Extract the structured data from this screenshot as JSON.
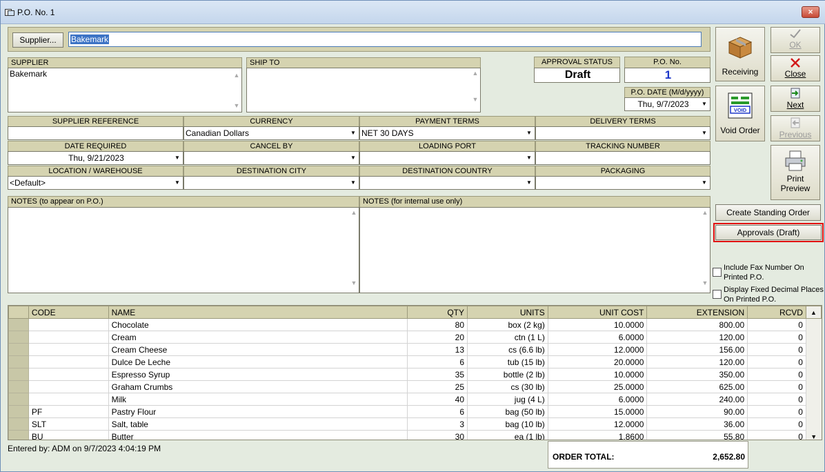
{
  "window": {
    "title": "P.O. No. 1",
    "close_label": "×"
  },
  "supplier_bar": {
    "button_label": "Supplier...",
    "value": "Bakemark"
  },
  "supplier_box": {
    "label": "SUPPLIER",
    "value": "Bakemark"
  },
  "ship_to": {
    "label": "SHIP TO",
    "value": ""
  },
  "approval_status": {
    "label": "APPROVAL STATUS",
    "value": "Draft"
  },
  "po_no": {
    "label": "P.O. No.",
    "value": "1"
  },
  "po_date": {
    "label": "P.O. DATE (M/d/yyyy)",
    "value": "Thu, 9/7/2023"
  },
  "fields": {
    "supplier_reference": {
      "label": "SUPPLIER REFERENCE",
      "value": ""
    },
    "currency": {
      "label": "CURRENCY",
      "value": "Canadian Dollars"
    },
    "payment_terms": {
      "label": "PAYMENT TERMS",
      "value": "NET 30 DAYS"
    },
    "delivery_terms": {
      "label": "DELIVERY TERMS",
      "value": ""
    },
    "date_required": {
      "label": "DATE REQUIRED",
      "value": "Thu, 9/21/2023"
    },
    "cancel_by": {
      "label": "CANCEL BY",
      "value": ""
    },
    "loading_port": {
      "label": "LOADING PORT",
      "value": ""
    },
    "tracking_number": {
      "label": "TRACKING NUMBER",
      "value": ""
    },
    "location": {
      "label": "LOCATION / WAREHOUSE",
      "value": "<Default>"
    },
    "destination_city": {
      "label": "DESTINATION CITY",
      "value": ""
    },
    "destination_country": {
      "label": "DESTINATION COUNTRY",
      "value": ""
    },
    "packaging": {
      "label": "PACKAGING",
      "value": ""
    }
  },
  "notes_po": {
    "label": "NOTES (to appear on P.O.)",
    "value": ""
  },
  "notes_internal": {
    "label": "NOTES (for internal use only)",
    "value": ""
  },
  "side": {
    "receiving": "Receiving",
    "ok": "OK",
    "close": "Close",
    "void_order": "Void Order",
    "next": "Next",
    "previous": "Previous",
    "print_preview_1": "Print",
    "print_preview_2": "Preview",
    "create_standing_order": "Create Standing Order",
    "approvals": "Approvals (Draft)",
    "include_fax_1": "Include Fax Number On",
    "include_fax_2": "Printed P.O.",
    "fixed_decimal_1": "Display Fixed Decimal Places",
    "fixed_decimal_2": "On Printed P.O.",
    "void_stamp": "VOID"
  },
  "grid": {
    "columns": [
      "CODE",
      "NAME",
      "QTY",
      "UNITS",
      "UNIT COST",
      "EXTENSION",
      "RCVD"
    ],
    "rows": [
      [
        "",
        "Chocolate",
        "80",
        "box (2 kg)",
        "10.0000",
        "800.00",
        "0"
      ],
      [
        "",
        "Cream",
        "20",
        "ctn (1 L)",
        "6.0000",
        "120.00",
        "0"
      ],
      [
        "",
        "Cream Cheese",
        "13",
        "cs (6.6 lb)",
        "12.0000",
        "156.00",
        "0"
      ],
      [
        "",
        "Dulce De Leche",
        "6",
        "tub (15 lb)",
        "20.0000",
        "120.00",
        "0"
      ],
      [
        "",
        "Espresso Syrup",
        "35",
        "bottle (2 lb)",
        "10.0000",
        "350.00",
        "0"
      ],
      [
        "",
        "Graham Crumbs",
        "25",
        "cs (30 lb)",
        "25.0000",
        "625.00",
        "0"
      ],
      [
        "",
        "Milk",
        "40",
        "jug (4 L)",
        "6.0000",
        "240.00",
        "0"
      ],
      [
        "PF",
        "Pastry Flour",
        "6",
        "bag (50 lb)",
        "15.0000",
        "90.00",
        "0"
      ],
      [
        "SLT",
        "Salt, table",
        "3",
        "bag (10 lb)",
        "12.0000",
        "36.00",
        "0"
      ],
      [
        "BU",
        "Butter",
        "30",
        "ea (1 lb)",
        "1.8600",
        "55.80",
        "0"
      ]
    ]
  },
  "footer": {
    "entered_by": "Entered by: ADM on 9/7/2023 4:04:19 PM",
    "order_total_label": "ORDER TOTAL:",
    "order_total_value": "2,652.80"
  },
  "colors": {
    "accent_red": "#e01010",
    "po_number_blue": "#1b35c8",
    "header_tan": "#d5d3b0",
    "window_bg": "#e4ebe0"
  }
}
